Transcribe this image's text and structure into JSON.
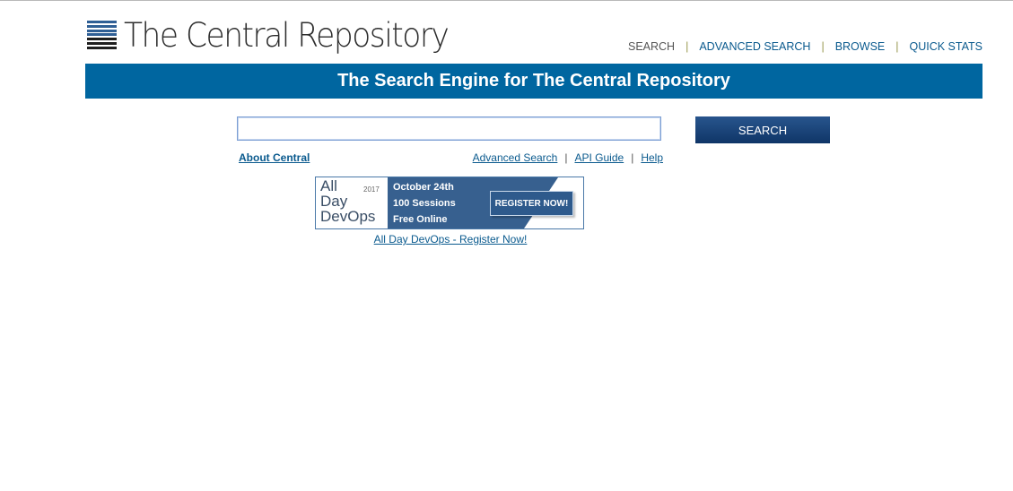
{
  "header": {
    "logo_text": "The Central Repository",
    "nav": [
      "SEARCH",
      "ADVANCED SEARCH",
      "BROWSE",
      "QUICK STATS"
    ],
    "nav_separator": "|"
  },
  "banner": {
    "title": "The Search Engine for The Central Repository"
  },
  "search": {
    "value": "",
    "button_label": "SEARCH"
  },
  "links": {
    "about": "About Central",
    "advanced": "Advanced Search",
    "api": "API Guide",
    "help": "Help",
    "separator": "|"
  },
  "ad": {
    "brand_line1": "All",
    "brand_line2": "Day",
    "brand_line3": "DevOps",
    "year": "2017",
    "line1": "October 24th",
    "line2": "100 Sessions",
    "line3": "Free Online",
    "cta": "REGISTER NOW!",
    "caption": "All Day DevOps - Register Now!"
  },
  "colors": {
    "banner_bg": "#0066a0",
    "link": "#0a5a8e",
    "button_bg": "#1f4677"
  }
}
